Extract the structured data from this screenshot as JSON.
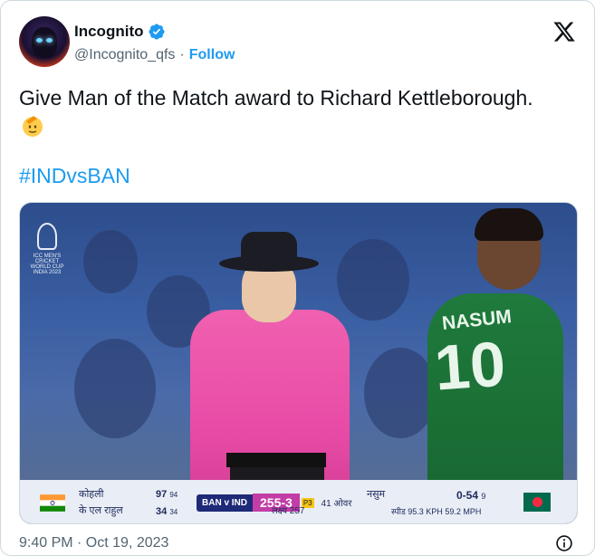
{
  "author": {
    "display_name": "Incognito",
    "handle": "@Incognito_qfs",
    "separator": "·",
    "follow_label": "Follow",
    "verified": true
  },
  "tweet": {
    "text": "Give Man of the Match award to Richard Kettleborough.",
    "emoji": "saluting-face",
    "hashtag": "#INDvsBAN"
  },
  "media": {
    "logo_text": "ICC MEN'S CRICKET WORLD CUP INDIA 2023",
    "jersey_name": "NASUM",
    "jersey_number": "10",
    "scorebar": {
      "batter1_name": "कोहली",
      "batter1_runs": "97",
      "batter1_balls": "94",
      "batter2_name": "के एल राहुल",
      "batter2_runs": "34",
      "batter2_balls": "34",
      "match_label": "BAN v IND",
      "score": "255-3",
      "powerplay": "P3",
      "overs": "41 ओवर",
      "target": "लक्ष्य 257",
      "bowler_name": "नसुम",
      "bowler_figures": "0-54",
      "bowler_overs": "9",
      "speed_label": "स्पीड",
      "speed_kph": "95.3 KPH",
      "speed_mph": "59.2 MPH"
    }
  },
  "footer": {
    "timestamp": "9:40 PM · Oct 19, 2023"
  },
  "colors": {
    "accent": "#1d9bf0",
    "text": "#0f1419",
    "muted": "#536471"
  }
}
